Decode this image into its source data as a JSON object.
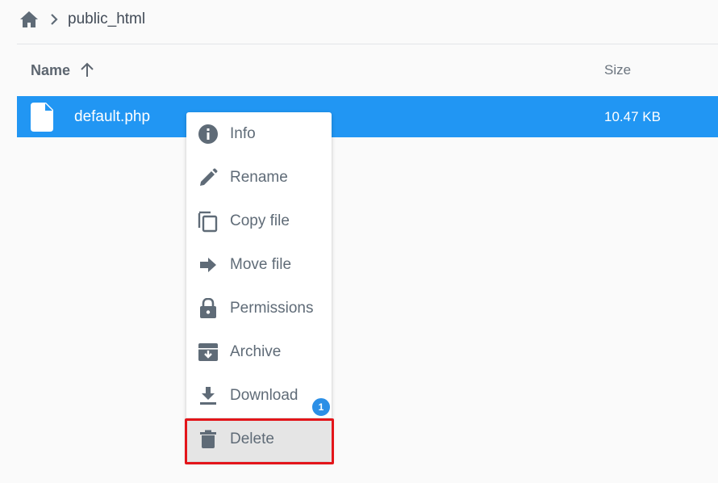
{
  "breadcrumb": {
    "home_icon": "home-icon",
    "separator_icon": "chevron-right-icon",
    "current": "public_html"
  },
  "table": {
    "columns": {
      "name": "Name",
      "size": "Size"
    },
    "sort_icon": "arrow-up-icon",
    "rows": [
      {
        "name": "default.php",
        "size": "10.47 KB",
        "icon": "file-icon",
        "selected": true
      }
    ]
  },
  "context_menu": {
    "items": [
      {
        "label": "Info",
        "icon": "info-icon"
      },
      {
        "label": "Rename",
        "icon": "pencil-icon"
      },
      {
        "label": "Copy file",
        "icon": "copy-icon"
      },
      {
        "label": "Move file",
        "icon": "arrow-right-icon"
      },
      {
        "label": "Permissions",
        "icon": "lock-icon"
      },
      {
        "label": "Archive",
        "icon": "archive-icon"
      },
      {
        "label": "Download",
        "icon": "download-icon"
      },
      {
        "label": "Delete",
        "icon": "trash-icon"
      }
    ]
  },
  "annotation": {
    "step_number": "1"
  },
  "colors": {
    "selection": "#2196f3",
    "highlight_border": "#e3151a",
    "badge": "#2b8fe6",
    "icon": "#5f6b77"
  }
}
